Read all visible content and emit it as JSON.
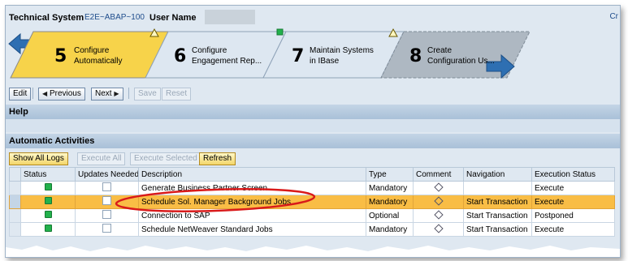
{
  "header": {
    "system_label": "Technical System",
    "system_value": "E2E~ABAP~100",
    "user_label": "User Name",
    "corner_link": "Cr"
  },
  "steps": [
    {
      "number": "5",
      "line1": "Configure",
      "line2": "Automatically",
      "status": "warning",
      "state": "active"
    },
    {
      "number": "6",
      "line1": "Configure",
      "line2": "Engagement Rep...",
      "status": "ok",
      "state": "normal"
    },
    {
      "number": "7",
      "line1": "Maintain Systems",
      "line2": "in IBase",
      "status": "warning",
      "state": "normal"
    },
    {
      "number": "8",
      "line1": "Create",
      "line2": "Configuration Us...",
      "status": "",
      "state": "next"
    }
  ],
  "toolbar": {
    "edit": "Edit",
    "previous": "Previous",
    "next": "Next",
    "save": "Save",
    "reset": "Reset"
  },
  "help": {
    "title": "Help"
  },
  "automatic": {
    "title": "Automatic Activities",
    "show_all_logs": "Show All Logs",
    "execute_all": "Execute All",
    "execute_selected": "Execute Selected",
    "refresh": "Refresh"
  },
  "table": {
    "columns": [
      "Status",
      "Updates Needed",
      "Description",
      "Type",
      "Comment",
      "Navigation",
      "Execution Status"
    ],
    "rows": [
      {
        "description": "Generate Business Partner Screen",
        "type": "Mandatory",
        "navigation": "",
        "execution": "Execute"
      },
      {
        "description": "Schedule Sol. Manager Background Jobs",
        "type": "Mandatory",
        "navigation": "Start Transaction",
        "execution": "Execute"
      },
      {
        "description": "Connection to SAP",
        "type": "Optional",
        "navigation": "Start Transaction",
        "execution": "Postponed"
      },
      {
        "description": "Schedule NetWeaver Standard Jobs",
        "type": "Mandatory",
        "navigation": "Start Transaction",
        "execution": "Execute"
      }
    ]
  },
  "colors": {
    "accent_yellow": "#f7d34a",
    "selected_row": "#f9bd45",
    "status_green": "#22b14c",
    "highlight_ellipse": "#d91a1a"
  }
}
